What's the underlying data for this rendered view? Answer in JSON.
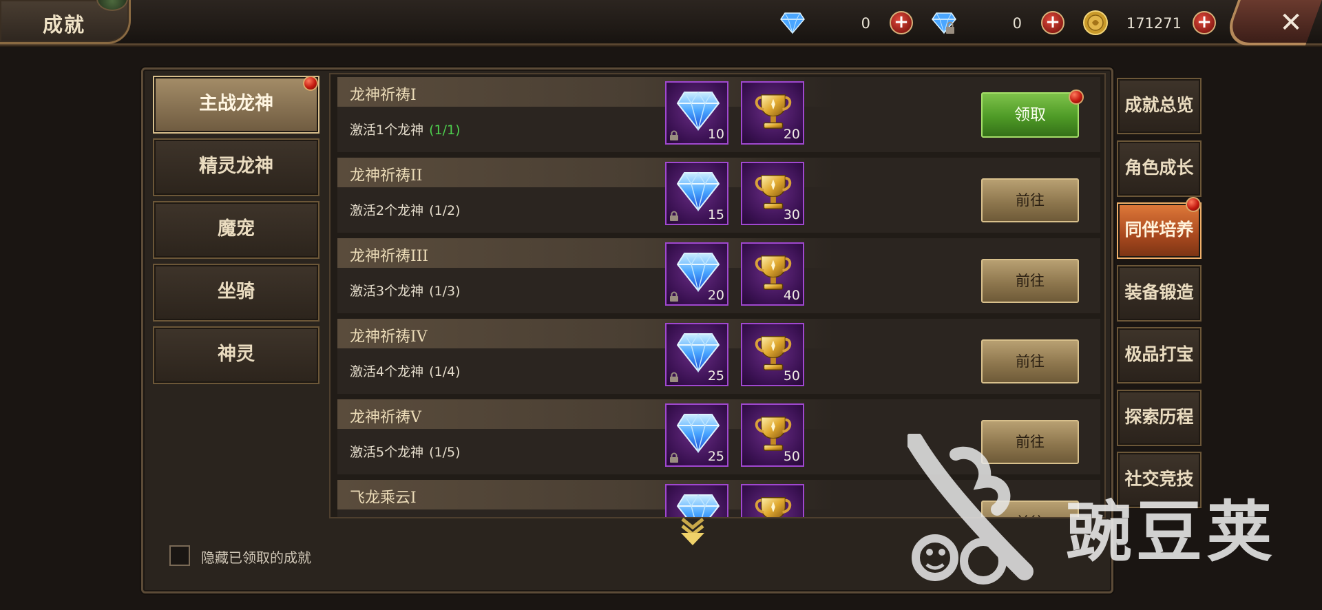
{
  "header": {
    "title": "成就",
    "currencies": [
      {
        "name": "diamond",
        "icon": "diamond-icon",
        "value": "0"
      },
      {
        "name": "bound-diamond",
        "icon": "locked-diamond-icon",
        "value": "0"
      },
      {
        "name": "gold",
        "icon": "gold-coin-icon",
        "value": "171271"
      }
    ],
    "plus_glyph": "+",
    "close_glyph": "✕"
  },
  "categories": [
    {
      "label": "主战龙神",
      "active": true,
      "badge": true
    },
    {
      "label": "精灵龙神",
      "active": false,
      "badge": false
    },
    {
      "label": "魔宠",
      "active": false,
      "badge": false
    },
    {
      "label": "坐骑",
      "active": false,
      "badge": false
    },
    {
      "label": "神灵",
      "active": false,
      "badge": false
    }
  ],
  "achievements": [
    {
      "title": "龙神祈祷I",
      "desc": "激活1个龙神",
      "progress": "(1/1)",
      "done": true,
      "rewards": [
        {
          "icon": "locked-diamond-icon",
          "amount": "10"
        },
        {
          "icon": "trophy-icon",
          "amount": "20"
        }
      ],
      "action": "领取",
      "badge": true
    },
    {
      "title": "龙神祈祷II",
      "desc": "激活2个龙神",
      "progress": "(1/2)",
      "done": false,
      "rewards": [
        {
          "icon": "locked-diamond-icon",
          "amount": "15"
        },
        {
          "icon": "trophy-icon",
          "amount": "30"
        }
      ],
      "action": "前往",
      "badge": false
    },
    {
      "title": "龙神祈祷III",
      "desc": "激活3个龙神",
      "progress": "(1/3)",
      "done": false,
      "rewards": [
        {
          "icon": "locked-diamond-icon",
          "amount": "20"
        },
        {
          "icon": "trophy-icon",
          "amount": "40"
        }
      ],
      "action": "前往",
      "badge": false
    },
    {
      "title": "龙神祈祷IV",
      "desc": "激活4个龙神",
      "progress": "(1/4)",
      "done": false,
      "rewards": [
        {
          "icon": "locked-diamond-icon",
          "amount": "25"
        },
        {
          "icon": "trophy-icon",
          "amount": "50"
        }
      ],
      "action": "前往",
      "badge": false
    },
    {
      "title": "龙神祈祷V",
      "desc": "激活5个龙神",
      "progress": "(1/5)",
      "done": false,
      "rewards": [
        {
          "icon": "locked-diamond-icon",
          "amount": "25"
        },
        {
          "icon": "trophy-icon",
          "amount": "50"
        }
      ],
      "action": "前往",
      "badge": false
    },
    {
      "title": "飞龙乘云I",
      "desc": "",
      "progress": "",
      "done": false,
      "rewards": [
        {
          "icon": "locked-diamond-icon",
          "amount": ""
        },
        {
          "icon": "trophy-icon",
          "amount": ""
        }
      ],
      "action": "前往",
      "badge": false
    }
  ],
  "side_tabs": [
    {
      "label": "成就总览",
      "active": false,
      "badge": false
    },
    {
      "label": "角色成长",
      "active": false,
      "badge": false
    },
    {
      "label": "同伴培养",
      "active": true,
      "badge": true
    },
    {
      "label": "装备锻造",
      "active": false,
      "badge": false
    },
    {
      "label": "极品打宝",
      "active": false,
      "badge": false
    },
    {
      "label": "探索历程",
      "active": false,
      "badge": false
    },
    {
      "label": "社交竞技",
      "active": false,
      "badge": false
    }
  ],
  "footer": {
    "hide_claimed_label": "隐藏已领取的成就",
    "hide_claimed_checked": false
  },
  "watermark": {
    "text": "豌豆荚",
    "icon": "wandoujia-logo-icon"
  },
  "colors": {
    "progress_done": "#4ed04e",
    "claim_button": "#4e9a26",
    "go_button": "#8e774e",
    "active_side_tab": "#a8481e",
    "reward_frame": "#a048d0"
  }
}
